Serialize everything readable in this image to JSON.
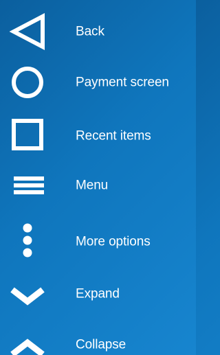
{
  "items": [
    {
      "label": "Back",
      "icon": "back-triangle-icon"
    },
    {
      "label": "Payment screen",
      "icon": "circle-icon"
    },
    {
      "label": "Recent items",
      "icon": "square-icon"
    },
    {
      "label": "Menu",
      "icon": "hamburger-menu-icon"
    },
    {
      "label": "More options",
      "icon": "vertical-dots-icon"
    },
    {
      "label": "Expand",
      "icon": "chevron-down-icon"
    },
    {
      "label": "Collapse",
      "icon": "chevron-up-icon"
    }
  ],
  "colors": {
    "background_start": "#0b5f9e",
    "background_end": "#1785cf",
    "foreground": "#ffffff"
  }
}
